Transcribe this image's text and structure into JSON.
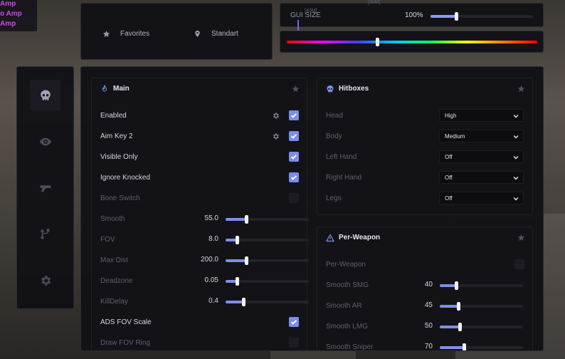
{
  "overlay": {
    "lines": [
      "Amp",
      "o Amp",
      "Amp"
    ]
  },
  "favorites": {
    "items": [
      {
        "label": "Favorites",
        "icon": "star-icon"
      },
      {
        "label": "Standart",
        "icon": "location-pin-icon"
      }
    ]
  },
  "gui_size": {
    "label": "GUI SIZE",
    "overlap_text": "[40M]",
    "top_text": "[30M]",
    "value": "100%",
    "level": 0.25
  },
  "hue": {
    "level": 0.36
  },
  "sidebar": {
    "items": [
      {
        "icon": "skull-icon",
        "active": true
      },
      {
        "icon": "eye-icon",
        "active": false
      },
      {
        "icon": "pistol-icon",
        "active": false
      },
      {
        "icon": "branch-icon",
        "active": false
      },
      {
        "icon": "gear-icon",
        "active": false
      }
    ]
  },
  "main_card": {
    "title": "Main",
    "rows": [
      {
        "label": "Enabled",
        "type": "check",
        "checked": true,
        "gear": true,
        "dim": false
      },
      {
        "label": "Aim Key 2",
        "type": "check",
        "checked": true,
        "gear": true,
        "dim": false
      },
      {
        "label": "Visible Only",
        "type": "check",
        "checked": true,
        "gear": false,
        "dim": false
      },
      {
        "label": "Ignore Knocked",
        "type": "check",
        "checked": true,
        "gear": false,
        "dim": false
      },
      {
        "label": "Bone Switch",
        "type": "check",
        "checked": false,
        "gear": false,
        "dim": true
      },
      {
        "label": "Smooth",
        "type": "slider",
        "value": "55.0",
        "level": 0.25,
        "dim": true
      },
      {
        "label": "FOV",
        "type": "slider",
        "value": "8.0",
        "level": 0.14,
        "dim": true
      },
      {
        "label": "Max Dist",
        "type": "slider",
        "value": "200.0",
        "level": 0.25,
        "dim": true
      },
      {
        "label": "Deadzone",
        "type": "slider",
        "value": "0.05",
        "level": 0.14,
        "dim": true
      },
      {
        "label": "KillDelay",
        "type": "slider",
        "value": "0.4",
        "level": 0.21,
        "dim": true
      },
      {
        "label": "ADS FOV Scale",
        "type": "check",
        "checked": true,
        "gear": false,
        "dim": false
      },
      {
        "label": "Draw FOV Ring",
        "type": "check",
        "checked": false,
        "gear": false,
        "dim": true
      }
    ]
  },
  "hitbox_card": {
    "title": "Hitboxes",
    "rows": [
      {
        "label": "Head",
        "value": "High"
      },
      {
        "label": "Body",
        "value": "Medium"
      },
      {
        "label": "Left Hand",
        "value": "Off"
      },
      {
        "label": "Right Hand",
        "value": "Off"
      },
      {
        "label": "Legs",
        "value": "Off"
      }
    ]
  },
  "weapon_card": {
    "title": "Per-Weapon",
    "rows": [
      {
        "label": "Per-Weapon",
        "type": "check",
        "checked": false
      },
      {
        "label": "Smooth SMG",
        "type": "slider",
        "value": "40",
        "level": 0.2
      },
      {
        "label": "Smooth AR",
        "type": "slider",
        "value": "45",
        "level": 0.22
      },
      {
        "label": "Smooth LMG",
        "type": "slider",
        "value": "50",
        "level": 0.24
      },
      {
        "label": "Smooth Sniper",
        "type": "slider",
        "value": "70",
        "level": 0.29
      }
    ]
  },
  "colors": {
    "accent": "#7a8cf0",
    "panel": "#131317"
  }
}
